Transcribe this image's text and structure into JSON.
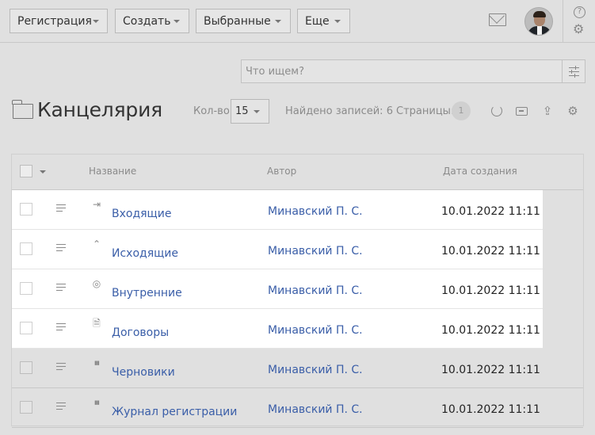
{
  "toolbar": {
    "menus": [
      {
        "label": "Регистрация"
      },
      {
        "label": "Создать"
      },
      {
        "label": "Выбранные"
      },
      {
        "label": "Еще"
      }
    ],
    "icons": {
      "mail": "mail-icon",
      "help": "help-icon",
      "settings": "gear-icon"
    },
    "help_glyph": "?"
  },
  "search": {
    "placeholder": "Что ищем?"
  },
  "header": {
    "title": "Канцелярия",
    "count_label": "Кол-во:",
    "count_value": "15",
    "found_label": "Найдено записей: 6",
    "pages_label": "Страницы:",
    "page_number": "1"
  },
  "table": {
    "columns": {
      "name": "Название",
      "author": "Автор",
      "created": "Дата создания"
    },
    "rows": [
      {
        "name": "Входящие",
        "author": "Минавский П. С.",
        "date": "10.01.2022 11:11",
        "icon": "incoming-icon",
        "highlighted": true
      },
      {
        "name": "Исходящие",
        "author": "Минавский П. С.",
        "date": "10.01.2022 11:11",
        "icon": "outgoing-icon",
        "highlighted": true
      },
      {
        "name": "Внутренние",
        "author": "Минавский П. С.",
        "date": "10.01.2022 11:11",
        "icon": "internal-icon",
        "highlighted": true
      },
      {
        "name": "Договоры",
        "author": "Минавский П. С.",
        "date": "10.01.2022 11:11",
        "icon": "document-icon",
        "highlighted": true
      },
      {
        "name": "Черновики",
        "author": "Минавский П. С.",
        "date": "10.01.2022 11:11",
        "icon": "book-icon",
        "highlighted": false
      },
      {
        "name": "Журнал регистрации",
        "author": "Минавский П. С.",
        "date": "10.01.2022 11:11",
        "icon": "book-icon",
        "highlighted": false
      }
    ]
  },
  "colors": {
    "link": "#3a5ea8",
    "background": "#e0e0e0",
    "row_highlight": "#ffffff"
  }
}
